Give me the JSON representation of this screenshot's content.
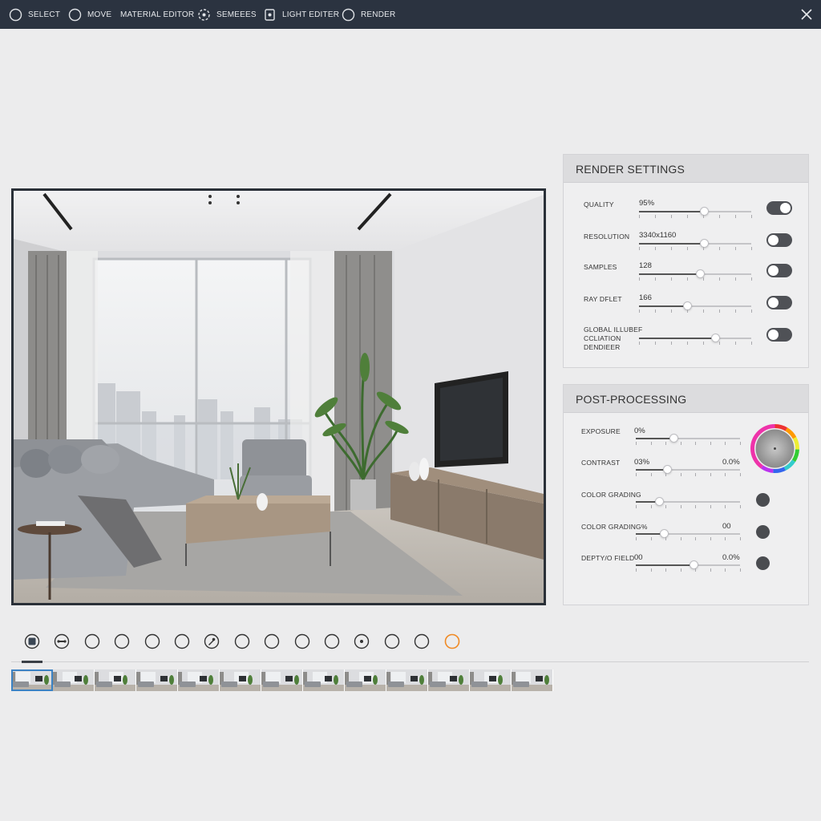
{
  "toolbar": {
    "items": [
      {
        "label": "SELECT",
        "icon": "circle-icon"
      },
      {
        "label": "MOVE",
        "icon": "circle-icon"
      },
      {
        "label": "MATERIAL EDITOR",
        "icon": ""
      },
      {
        "label": "SEMEEES",
        "icon": "dotted-circle-icon"
      },
      {
        "label": "LIGHT EDITER",
        "icon": "light-file-icon"
      },
      {
        "label": "RENDER",
        "icon": "circle-icon"
      }
    ],
    "close_icon": "close-icon"
  },
  "render_settings": {
    "title": "RENDER SETTINGS",
    "rows": [
      {
        "label": "QUALITY",
        "value": "95%",
        "level": 0.58,
        "toggle": true
      },
      {
        "label": "RESOLUTION",
        "value": "3340x1160",
        "level": 0.58,
        "toggle": false
      },
      {
        "label": "SAMPLES",
        "value": "128",
        "level": 0.54,
        "toggle": false
      },
      {
        "label": "RAY DFLET",
        "value": "166",
        "level": 0.43,
        "toggle": false
      },
      {
        "label": "GLOBAL ILLUBEF CCLIATION DENDIEER",
        "value": "",
        "level": 0.68,
        "toggle": false
      }
    ]
  },
  "post_processing": {
    "title": "POST-PROCESSING",
    "rows": [
      {
        "label": "EXPOSURE",
        "value": "0%",
        "value2": "",
        "level": 0.36,
        "control": "color-wheel-icon"
      },
      {
        "label": "CONTRAST",
        "value": "03%",
        "value2": "0.0%",
        "level": 0.3,
        "control": ""
      },
      {
        "label": "COLOR GRADING",
        "value": "",
        "value2": "",
        "level": 0.22,
        "control": "dot"
      },
      {
        "label": "COLOR GRADING%",
        "value": "",
        "value2": "00",
        "level": 0.27,
        "control": "dot"
      },
      {
        "label": "DEPTY/O FIELD",
        "value": "00",
        "value2": "0.0%",
        "level": 0.55,
        "control": "dot"
      }
    ]
  },
  "bottom_tools": {
    "icons": [
      "stop-icon",
      "link-icon",
      "circle-icon",
      "circle-icon",
      "circle-icon",
      "circle-icon",
      "brush-icon",
      "circle-icon",
      "circle-icon",
      "circle-icon",
      "circle-icon",
      "target-icon",
      "circle-icon",
      "circle-icon",
      "record-icon"
    ],
    "accent_color": "#f08a24"
  },
  "timeline": {
    "thumbnail_count": 13,
    "selected_index": 0
  }
}
